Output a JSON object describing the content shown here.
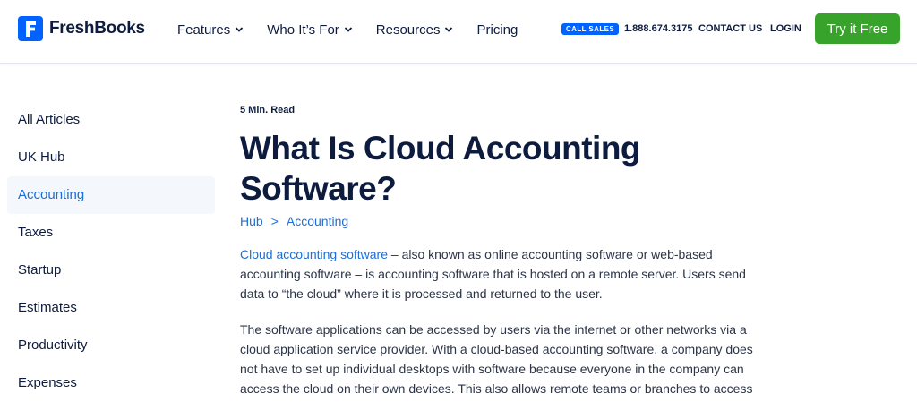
{
  "brand": {
    "name": "FreshBooks",
    "logo_letter": "F",
    "color": "#0063ff"
  },
  "nav": {
    "items": [
      {
        "label": "Features",
        "has_dropdown": true
      },
      {
        "label": "Who It’s For",
        "has_dropdown": true
      },
      {
        "label": "Resources",
        "has_dropdown": true
      },
      {
        "label": "Pricing",
        "has_dropdown": false
      }
    ],
    "call_sales": "CALL SALES",
    "phone": "1.888.674.3175",
    "contact": "CONTACT US",
    "login": "LOGIN",
    "cta": "Try it Free",
    "cta_color": "#37a32b"
  },
  "sidebar": {
    "items": [
      {
        "label": "All Articles",
        "active": false
      },
      {
        "label": "UK Hub",
        "active": false
      },
      {
        "label": "Accounting",
        "active": true
      },
      {
        "label": "Taxes",
        "active": false
      },
      {
        "label": "Startup",
        "active": false
      },
      {
        "label": "Estimates",
        "active": false
      },
      {
        "label": "Productivity",
        "active": false
      },
      {
        "label": "Expenses",
        "active": false
      }
    ]
  },
  "article": {
    "read_time": "5 Min. Read",
    "title": "What Is Cloud Accounting Software?",
    "breadcrumb": {
      "hub": "Hub",
      "separator": ">",
      "category": "Accounting"
    },
    "para1_link": "Cloud accounting software",
    "para1_rest": " – also known as online accounting software or web-based accounting software – is accounting software that is hosted on a remote server. Users send data to “the cloud” where it is processed and returned to the user.",
    "para2": "The software applications can be accessed by users via the internet or other networks via a cloud application service provider. With a cloud-based accounting software, a company does not have to set up individual desktops with software because everyone in the company can access the cloud on their own devices. This also allows remote teams or branches to access"
  },
  "colors": {
    "link": "#1f6ed4",
    "text": "#0d1b3e",
    "active_bg": "#f4f7fc"
  }
}
